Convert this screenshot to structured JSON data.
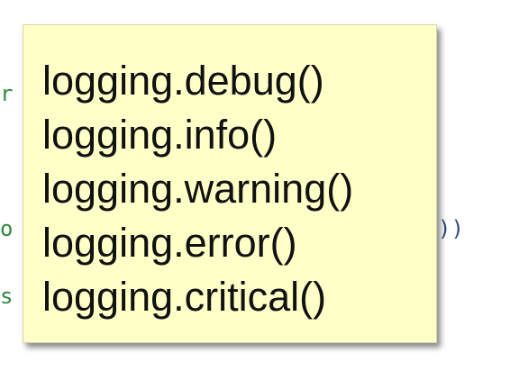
{
  "tooltip": {
    "lines": [
      "logging.debug()",
      "logging.info()",
      "logging.warning()",
      "logging.error()",
      "logging.critical()"
    ]
  },
  "background_code": {
    "frag1": "r",
    "frag2": "o",
    "frag3": "s",
    "frag4": "))"
  },
  "colors": {
    "tooltip_bg": "#ffffc8",
    "code_green": "#2f8a3e",
    "code_blue": "#2d4f7c"
  }
}
